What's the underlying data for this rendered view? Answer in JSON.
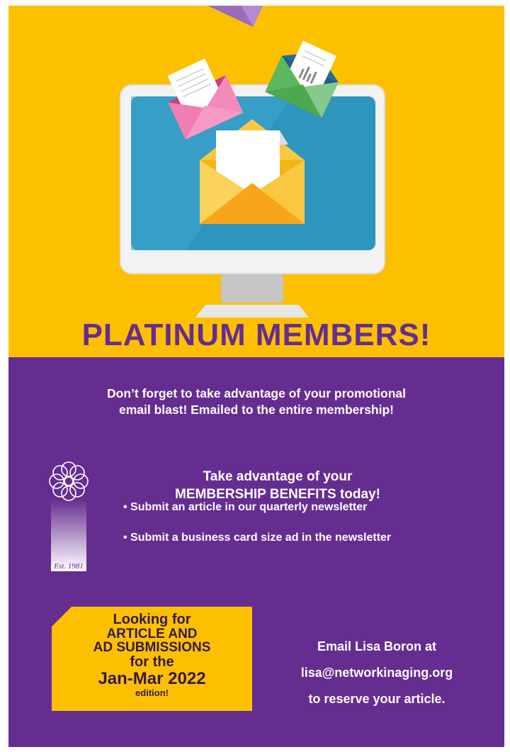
{
  "headline": "PLATINUM MEMBERS!",
  "intro": {
    "line1": "Don’t forget to take advantage of your promotional",
    "line2": "email blast! Emailed to the entire membership!"
  },
  "benefits": {
    "title_line1": "Take advantage of your",
    "title_line2": "MEMBERSHIP BENEFITS today!",
    "items": [
      "• Submit an article in our quarterly newsletter",
      "• Submit a business card size ad in the newsletter"
    ]
  },
  "logo": {
    "icon": "flower-logo-icon",
    "est": "Est. 1981"
  },
  "callout": {
    "line1": "Looking for",
    "line2": "ARTICLE AND",
    "line3": "AD SUBMISSIONS",
    "line4": "for the",
    "line5": "Jan-Mar 2022",
    "line6": "edition!"
  },
  "contact": {
    "line1": "Email Lisa Boron at",
    "line2": "lisa@networkinaging.org",
    "line3": "to reserve your article."
  },
  "colors": {
    "gold": "#fcc000",
    "purple": "#662d91",
    "screen": "#2e95be"
  },
  "illustration": {
    "icon": "computer-monitor-with-email-envelopes-icon"
  }
}
